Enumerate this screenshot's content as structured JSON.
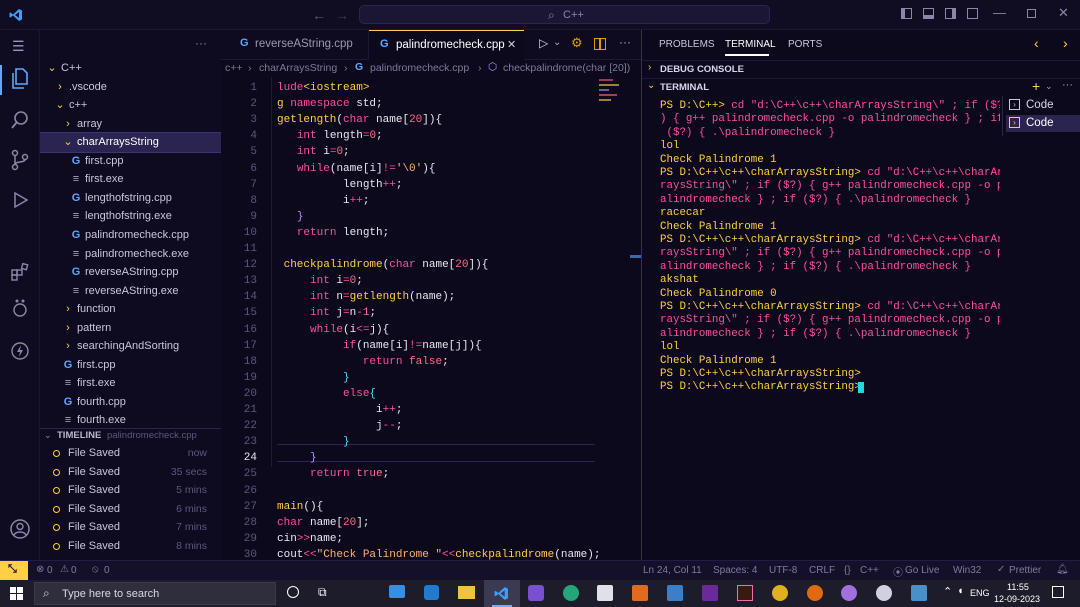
{
  "titlebar": {
    "search": "C++",
    "search_icon": "search-icon",
    "logo": "vscode-logo-icon"
  },
  "sidebar": {
    "root": "C++",
    "items": [
      {
        "label": "C++",
        "indent": 0,
        "type": "folder-open",
        "icon": "chevron-down"
      },
      {
        "label": ".vscode",
        "indent": 1,
        "type": "folder",
        "icon": "chevron-right"
      },
      {
        "label": "c++",
        "indent": 1,
        "type": "folder-open",
        "icon": "chevron-down"
      },
      {
        "label": "array",
        "indent": 2,
        "type": "folder",
        "icon": "chevron-right"
      },
      {
        "label": "charArraysString",
        "indent": 2,
        "type": "folder-open",
        "icon": "chevron-down"
      },
      {
        "label": "first.cpp",
        "indent": 3,
        "type": "cpp",
        "icon": "G"
      },
      {
        "label": "first.exe",
        "indent": 3,
        "type": "exe",
        "icon": "≡"
      },
      {
        "label": "lengthofstring.cpp",
        "indent": 3,
        "type": "cpp",
        "icon": "G"
      },
      {
        "label": "lengthofstring.exe",
        "indent": 3,
        "type": "exe",
        "icon": "≡"
      },
      {
        "label": "palindromecheck.cpp",
        "indent": 3,
        "type": "cpp",
        "icon": "G"
      },
      {
        "label": "palindromecheck.exe",
        "indent": 3,
        "type": "exe",
        "icon": "≡"
      },
      {
        "label": "reverseAString.cpp",
        "indent": 3,
        "type": "cpp",
        "icon": "G"
      },
      {
        "label": "reverseAString.exe",
        "indent": 3,
        "type": "exe",
        "icon": "≡"
      },
      {
        "label": "function",
        "indent": 2,
        "type": "folder",
        "icon": "chevron-right"
      },
      {
        "label": "pattern",
        "indent": 2,
        "type": "folder",
        "icon": "chevron-right"
      },
      {
        "label": "searchingAndSorting",
        "indent": 2,
        "type": "folder",
        "icon": "chevron-right"
      },
      {
        "label": "first.cpp",
        "indent": 2,
        "type": "cpp",
        "icon": "G"
      },
      {
        "label": "first.exe",
        "indent": 2,
        "type": "exe",
        "icon": "≡"
      },
      {
        "label": "fourth.cpp",
        "indent": 2,
        "type": "cpp",
        "icon": "G"
      },
      {
        "label": "fourth.exe",
        "indent": 2,
        "type": "exe",
        "icon": "≡"
      }
    ],
    "timeline": {
      "title": "TIMELINE",
      "file": "palindromecheck.cpp",
      "entries": [
        {
          "label": "File Saved",
          "time": "now"
        },
        {
          "label": "File Saved",
          "time": "35 secs"
        },
        {
          "label": "File Saved",
          "time": "5 mins"
        },
        {
          "label": "File Saved",
          "time": "6 mins"
        },
        {
          "label": "File Saved",
          "time": "7 mins"
        },
        {
          "label": "File Saved",
          "time": "8 mins"
        }
      ]
    }
  },
  "editor": {
    "tabs": [
      {
        "label": "reverseAString.cpp",
        "active": false
      },
      {
        "label": "palindromecheck.cpp",
        "active": true
      }
    ],
    "breadcrumb": [
      "c++",
      "charArraysString",
      "palindromecheck.cpp",
      "checkpalindrome(char [20])"
    ]
  },
  "panel": {
    "tabs": [
      "PROBLEMS",
      "TERMINAL",
      "PORTS"
    ],
    "active_tab": "TERMINAL",
    "debug_console": "DEBUG CONSOLE",
    "terminal_header": "TERMINAL",
    "sessions": [
      "Code",
      "Code"
    ]
  },
  "terminal_lines": [
    "PS D:\\C++> cd \"d:\\C++\\c++\\charArraysString\\\" ; if ($?",
    ") { g++ palindromecheck.cpp -o palindromecheck } ; if",
    " ($?) { .\\palindromecheck }",
    "lol",
    "Check Palindrome 1",
    "PS D:\\C++\\c++\\charArraysString> cd \"d:\\C++\\c++\\charAr",
    "raysString\\\" ; if ($?) { g++ palindromecheck.cpp -o p",
    "alindromecheck } ; if ($?) { .\\palindromecheck }",
    "racecar",
    "Check Palindrome 1",
    "PS D:\\C++\\c++\\charArraysString> cd \"d:\\C++\\c++\\charAr",
    "raysString\\\" ; if ($?) { g++ palindromecheck.cpp -o p",
    "alindromecheck } ; if ($?) { .\\palindromecheck }",
    "akshat",
    "Check Palindrome 0",
    "PS D:\\C++\\c++\\charArraysString> cd \"d:\\C++\\c++\\charAr",
    "raysString\\\" ; if ($?) { g++ palindromecheck.cpp -o p",
    "alindromecheck } ; if ($?) { .\\palindromecheck }",
    "lol",
    "Check Palindrome 1",
    "PS D:\\C++\\c++\\charArraysString>",
    "PS D:\\C++\\c++\\charArraysString>"
  ],
  "status": {
    "errors": "0",
    "warnings": "0",
    "ports": "0",
    "position": "Ln 24, Col 11",
    "spaces": "Spaces: 4",
    "encoding": "UTF-8",
    "eol": "CRLF",
    "language": "C++",
    "golive": "Go Live",
    "platform": "Win32",
    "prettier": "Prettier"
  },
  "taskbar": {
    "search": "Type here to search",
    "lang": "ENG",
    "time": "11:55",
    "date": "12-09-2023"
  },
  "colors": {
    "accent": "#ffcf44",
    "keyword": "#ff4f9a",
    "function": "#ffcf44",
    "bg": "#0c091c",
    "panel_border": "#3a2a6a"
  }
}
